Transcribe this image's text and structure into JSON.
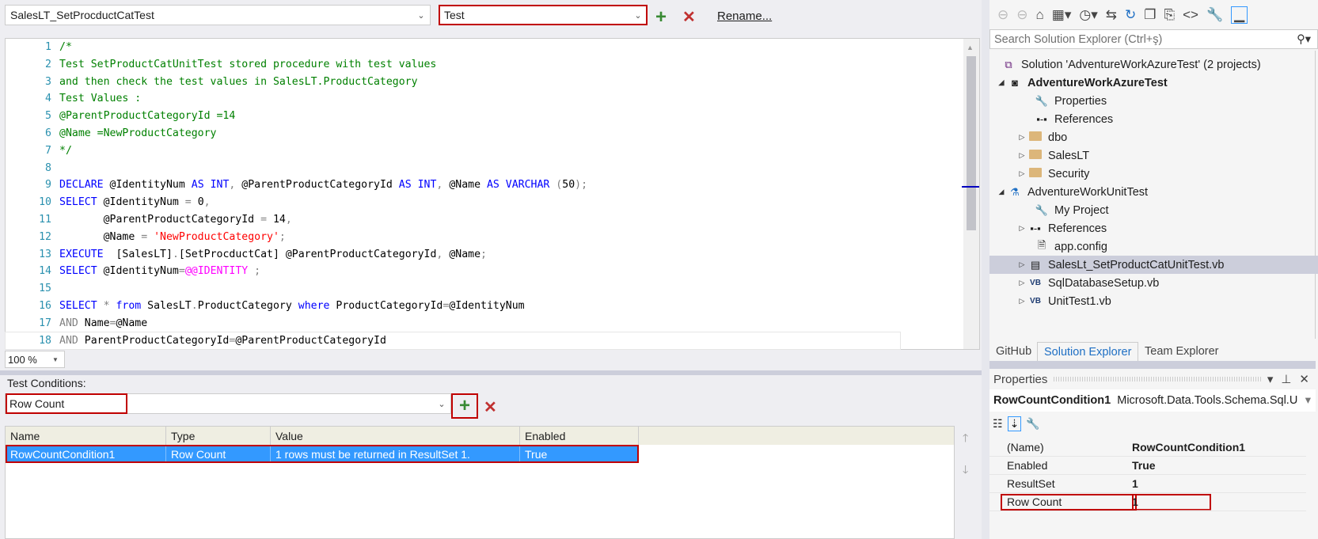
{
  "top": {
    "object_combo": "SalesLT_SetProcductCatTest",
    "type_combo": "Test",
    "rename": "Rename..."
  },
  "code_lines": [
    {
      "n": "1",
      "parts": [
        [
          "cm",
          "/*"
        ]
      ]
    },
    {
      "n": "2",
      "parts": [
        [
          "cm",
          "Test SetProductCatUnitTest stored procedure with test values"
        ]
      ]
    },
    {
      "n": "3",
      "parts": [
        [
          "cm",
          "and then check the test values in SalesLT.ProductCategory"
        ]
      ]
    },
    {
      "n": "4",
      "parts": [
        [
          "cm",
          "Test Values :"
        ]
      ]
    },
    {
      "n": "5",
      "parts": [
        [
          "cm",
          "@ParentProductCategoryId =14"
        ]
      ]
    },
    {
      "n": "6",
      "parts": [
        [
          "cm",
          "@Name =NewProductCategory"
        ]
      ]
    },
    {
      "n": "7",
      "parts": [
        [
          "cm",
          "*/"
        ]
      ]
    },
    {
      "n": "8",
      "parts": []
    },
    {
      "n": "9",
      "parts": [
        [
          "kw",
          "DECLARE "
        ],
        [
          "tx",
          "@IdentityNum "
        ],
        [
          "kw",
          "AS INT"
        ],
        [
          "gr",
          ", "
        ],
        [
          "tx",
          "@ParentProductCategoryId "
        ],
        [
          "kw",
          "AS INT"
        ],
        [
          "gr",
          ", "
        ],
        [
          "tx",
          "@Name "
        ],
        [
          "kw",
          "AS VARCHAR "
        ],
        [
          "gr",
          "("
        ],
        [
          "tx",
          "50"
        ],
        [
          "gr",
          ");"
        ]
      ]
    },
    {
      "n": "10",
      "parts": [
        [
          "kw",
          "SELECT "
        ],
        [
          "tx",
          "@IdentityNum "
        ],
        [
          "gr",
          "= "
        ],
        [
          "tx",
          "0"
        ],
        [
          "gr",
          ","
        ]
      ]
    },
    {
      "n": "11",
      "parts": [
        [
          "tx",
          "       @ParentProductCategoryId "
        ],
        [
          "gr",
          "= "
        ],
        [
          "tx",
          "14"
        ],
        [
          "gr",
          ","
        ]
      ]
    },
    {
      "n": "12",
      "parts": [
        [
          "tx",
          "       @Name "
        ],
        [
          "gr",
          "= "
        ],
        [
          "str",
          "'NewProductCategory'"
        ],
        [
          "gr",
          ";"
        ]
      ]
    },
    {
      "n": "13",
      "parts": [
        [
          "kw",
          "EXECUTE  "
        ],
        [
          "tx",
          "[SalesLT]"
        ],
        [
          "gr",
          "."
        ],
        [
          "tx",
          "[SetProcductCat] @ParentProductCategoryId"
        ],
        [
          "gr",
          ", "
        ],
        [
          "tx",
          "@Name"
        ],
        [
          "gr",
          ";"
        ]
      ]
    },
    {
      "n": "14",
      "parts": [
        [
          "kw",
          "SELECT "
        ],
        [
          "tx",
          "@IdentityNum"
        ],
        [
          "gr",
          "="
        ],
        [
          "fn",
          "@@IDENTITY"
        ],
        [
          "tx",
          " "
        ],
        [
          "gr",
          ";"
        ]
      ]
    },
    {
      "n": "15",
      "parts": []
    },
    {
      "n": "16",
      "parts": [
        [
          "kw",
          "SELECT "
        ],
        [
          "gr",
          "* "
        ],
        [
          "kw",
          "from "
        ],
        [
          "tx",
          "SalesLT"
        ],
        [
          "gr",
          "."
        ],
        [
          "tx",
          "ProductCategory "
        ],
        [
          "kw",
          "where "
        ],
        [
          "tx",
          "ProductCategoryId"
        ],
        [
          "gr",
          "="
        ],
        [
          "tx",
          "@IdentityNum"
        ]
      ]
    },
    {
      "n": "17",
      "parts": [
        [
          "gr",
          "AND "
        ],
        [
          "tx",
          "Name"
        ],
        [
          "gr",
          "="
        ],
        [
          "tx",
          "@Name"
        ]
      ]
    },
    {
      "n": "18",
      "parts": [
        [
          "gr",
          "AND "
        ],
        [
          "tx",
          "ParentProductCategoryId"
        ],
        [
          "gr",
          "="
        ],
        [
          "tx",
          "@ParentProductCategoryId"
        ]
      ]
    }
  ],
  "zoom": "100 %",
  "conditions": {
    "label": "Test Conditions:",
    "type_combo": "Row Count",
    "columns": [
      "Name",
      "Type",
      "Value",
      "Enabled"
    ],
    "rows": [
      {
        "name": "RowCountCondition1",
        "type": "Row Count",
        "value": "1 rows must be returned in ResultSet 1.",
        "enabled": "True"
      }
    ]
  },
  "solution": {
    "search_placeholder": "Search Solution Explorer (Ctrl+ş)",
    "items": [
      {
        "label": "Solution 'AdventureWorkAzureTest' (2 projects)"
      },
      {
        "label": "AdventureWorkAzureTest"
      },
      {
        "label": "Properties"
      },
      {
        "label": "References"
      },
      {
        "label": "dbo"
      },
      {
        "label": "SalesLT"
      },
      {
        "label": "Security"
      },
      {
        "label": "AdventureWorkUnitTest"
      },
      {
        "label": "My Project"
      },
      {
        "label": "References"
      },
      {
        "label": "app.config"
      },
      {
        "label": "SalesLt_SetProductCatUnitTest.vb"
      },
      {
        "label": "SqlDatabaseSetup.vb"
      },
      {
        "label": "UnitTest1.vb"
      }
    ],
    "tabs": [
      "GitHub",
      "Solution Explorer",
      "Team Explorer"
    ]
  },
  "properties": {
    "title": "Properties",
    "object": "RowCountCondition1",
    "object_type": "Microsoft.Data.Tools.Schema.Sql.U",
    "rows": [
      {
        "k": "(Name)",
        "v": "RowCountCondition1"
      },
      {
        "k": "Enabled",
        "v": "True"
      },
      {
        "k": "ResultSet",
        "v": "1"
      },
      {
        "k": "Row Count",
        "v": "1"
      }
    ]
  }
}
